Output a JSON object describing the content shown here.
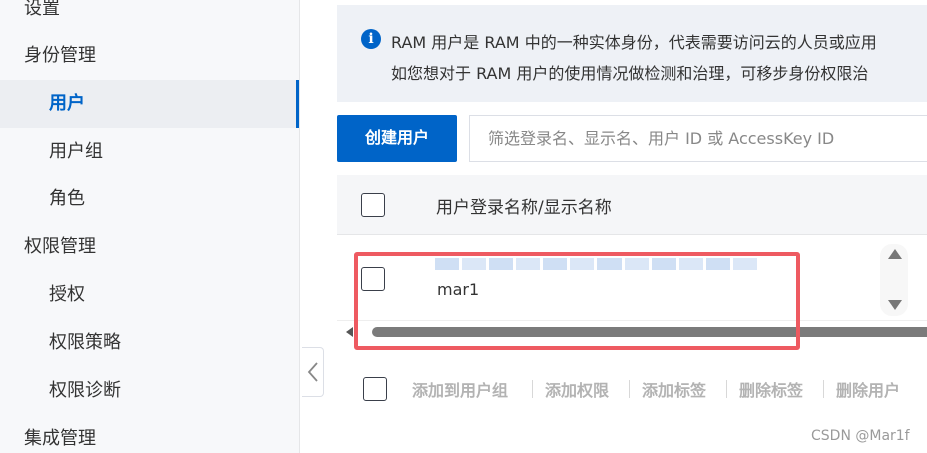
{
  "sidebar": {
    "items": [
      {
        "label": "设置"
      },
      {
        "label": "身份管理"
      },
      {
        "label": "用户"
      },
      {
        "label": "用户组"
      },
      {
        "label": "角色"
      },
      {
        "label": "权限管理"
      },
      {
        "label": "授权"
      },
      {
        "label": "权限策略"
      },
      {
        "label": "权限诊断"
      },
      {
        "label": "集成管理"
      }
    ],
    "active": "用户"
  },
  "banner": {
    "icon": "info-icon",
    "line1": "RAM 用户是 RAM 中的一种实体身份，代表需要访问云的人员或应用",
    "line2": "如您想对于 RAM 用户的使用情况做检测和治理，可移步身份权限治"
  },
  "toolbar": {
    "create_label": "创建用户",
    "filter_placeholder": "筛选登录名、显示名、用户 ID 或 AccessKey ID"
  },
  "table": {
    "column_header": "用户登录名称/显示名称",
    "rows": [
      {
        "display_name": "",
        "login_name": "mar1"
      }
    ]
  },
  "bulk_actions": [
    "添加到用户组",
    "添加权限",
    "添加标签",
    "删除标签",
    "删除用户"
  ],
  "watermark": "CSDN @Mar1f",
  "colors": {
    "primary": "#0064c8",
    "highlight": "#ee5a61",
    "disabled_text": "#b3b3b3"
  }
}
